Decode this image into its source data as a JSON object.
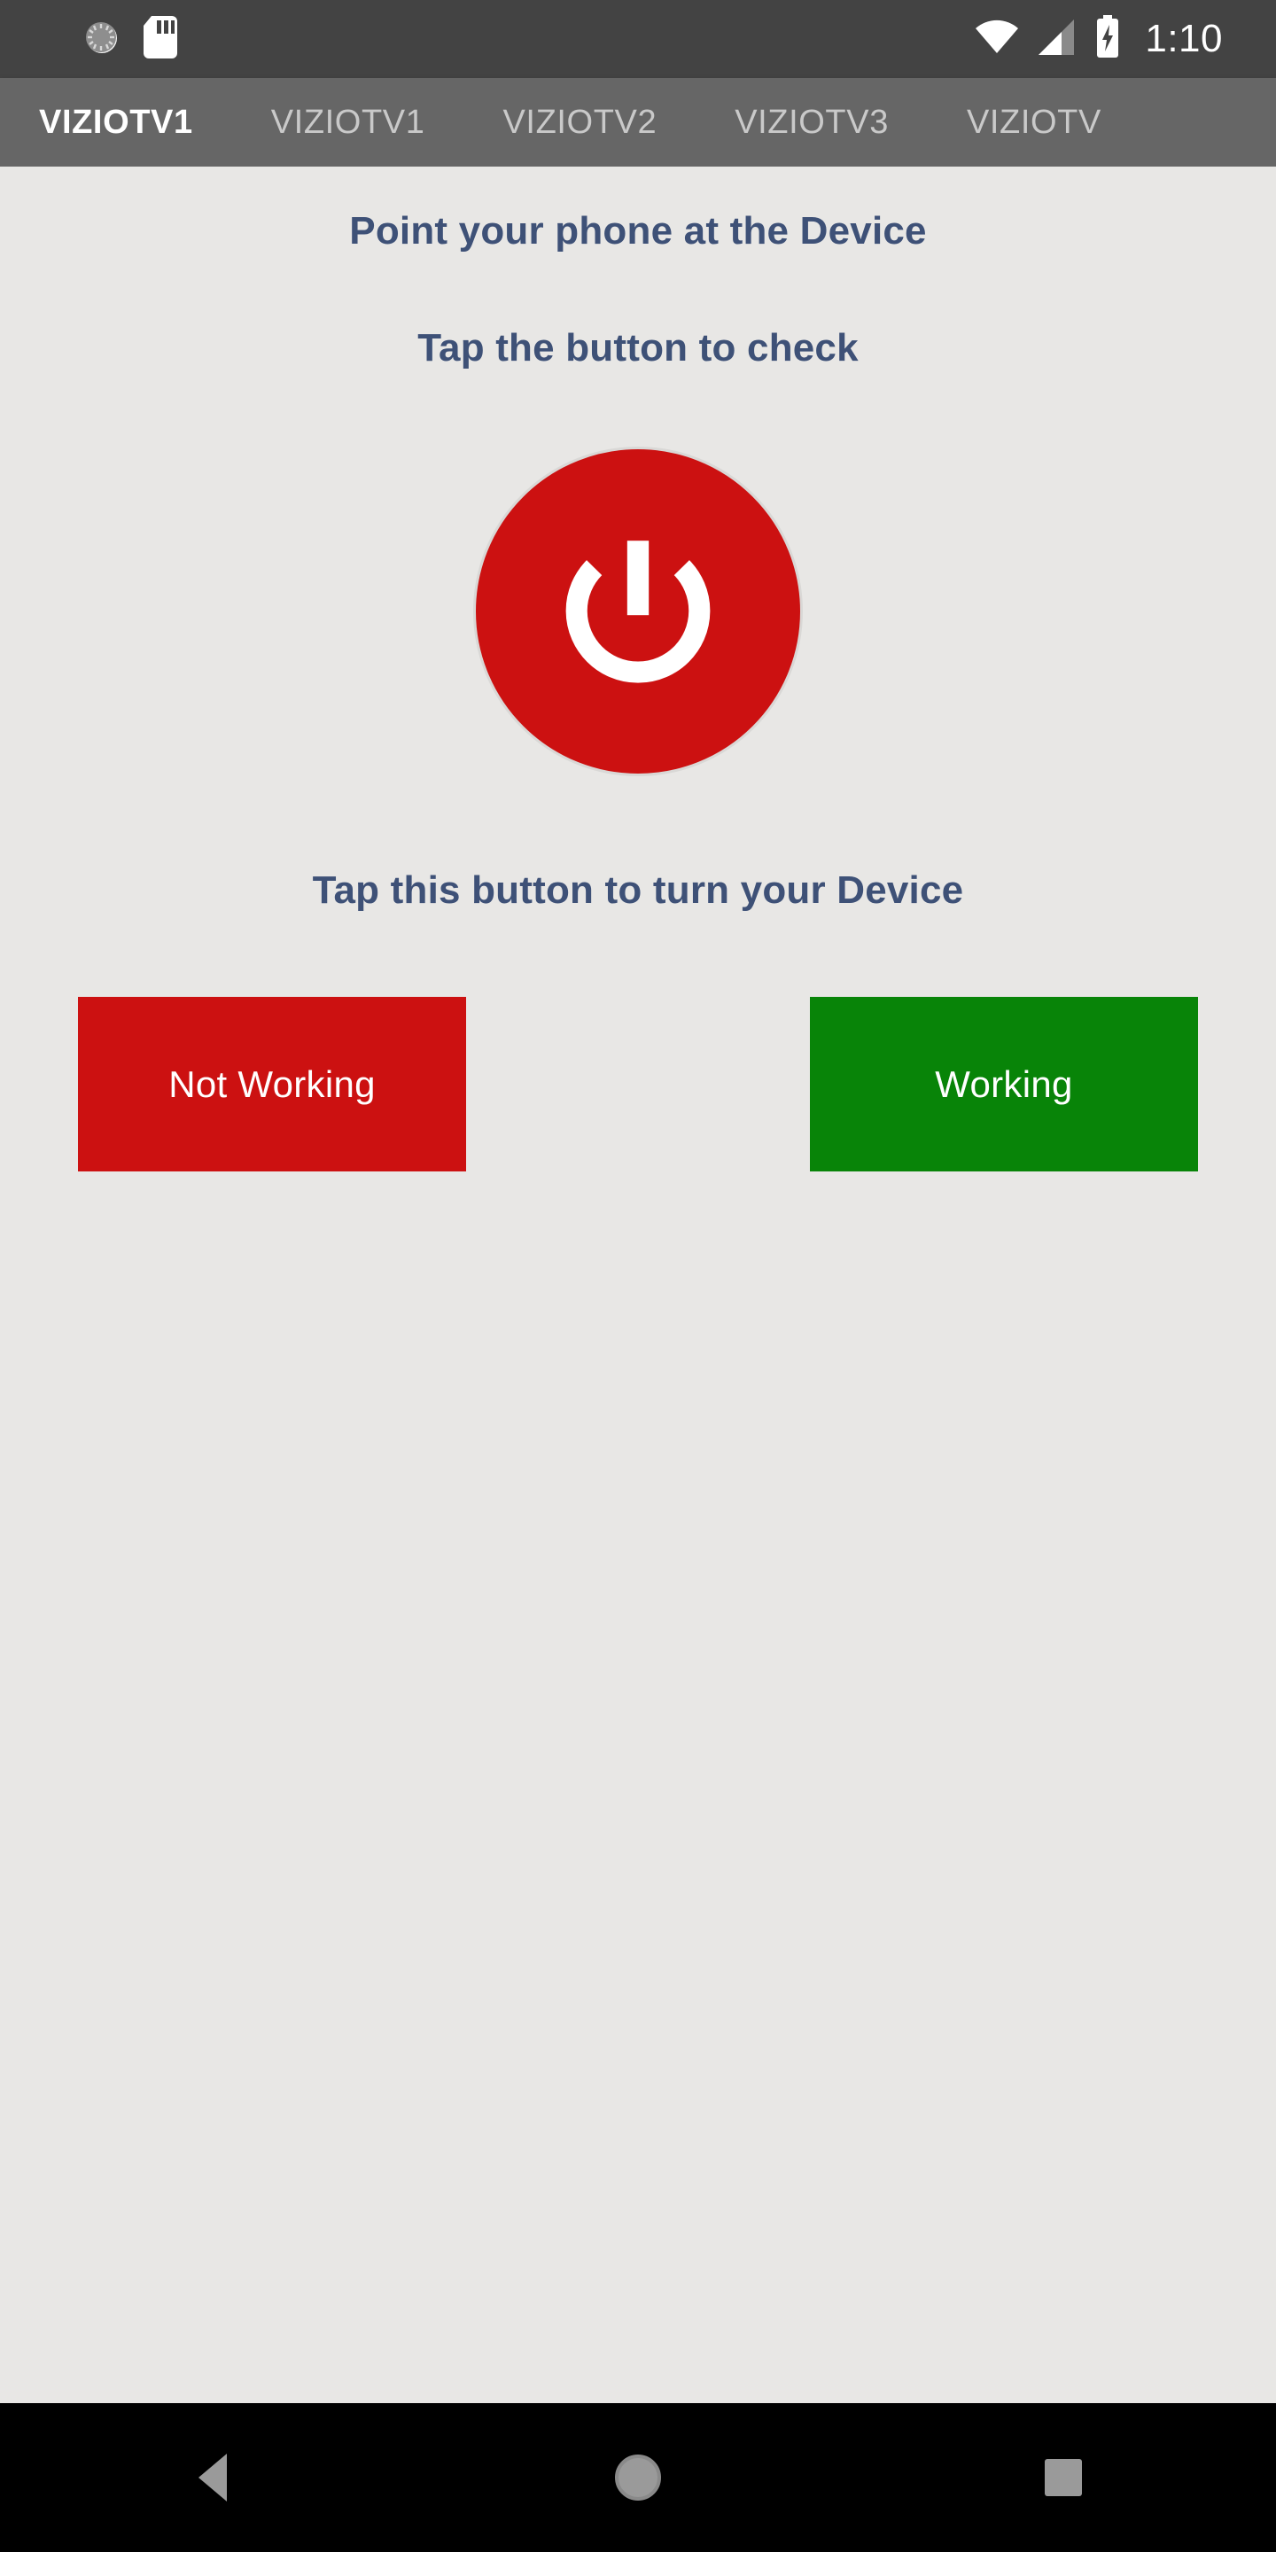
{
  "status_bar": {
    "time": "1:10",
    "icons": {
      "sync": "sync-spinner-icon",
      "sd_card": "sd-card-icon",
      "wifi": "wifi-icon",
      "cellular": "cellular-signal-icon",
      "battery": "battery-charging-icon"
    },
    "background_color": "#434343"
  },
  "tabs": {
    "background_color": "#666666",
    "active_index": 0,
    "items": [
      {
        "label": "VIZIOTV1",
        "active": true
      },
      {
        "label": "VIZIOTV1",
        "active": false
      },
      {
        "label": "VIZIOTV2",
        "active": false
      },
      {
        "label": "VIZIOTV3",
        "active": false
      },
      {
        "label": "VIZIOTV",
        "active": false
      }
    ]
  },
  "main": {
    "background_color": "#E8E7E5",
    "heading_color": "#3E5177",
    "heading_1": "Point your phone at the Device",
    "heading_2": "Tap the button to check",
    "heading_3": "Tap this button to turn your Device",
    "power_button": {
      "name": "power-button",
      "color": "#CC1111",
      "glyph_color": "#FFFFFF",
      "icon": "power-icon"
    },
    "actions": [
      {
        "label": "Not Working",
        "color": "#CC1111",
        "name": "not-working-button"
      },
      {
        "label": "Working",
        "color": "#088408",
        "name": "working-button"
      }
    ]
  },
  "nav_bar": {
    "background_color": "#000000",
    "icon_color": "#9A9A9A",
    "items": [
      {
        "name": "nav-back-button",
        "icon": "back-triangle-icon"
      },
      {
        "name": "nav-home-button",
        "icon": "home-circle-icon"
      },
      {
        "name": "nav-recents-button",
        "icon": "recents-square-icon"
      }
    ]
  }
}
